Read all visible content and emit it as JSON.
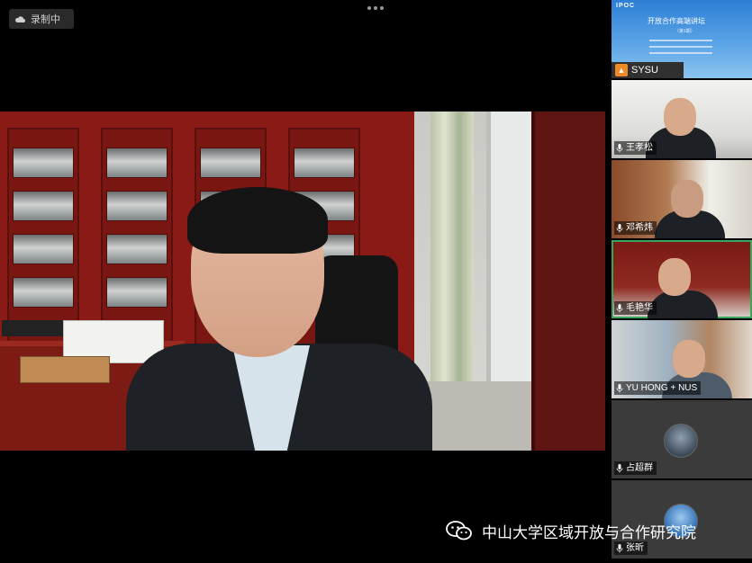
{
  "top_bar": {
    "recording_label": "录制中"
  },
  "main_speaker": {
    "name": ""
  },
  "sidebar": {
    "shared_screen": {
      "slide_logo": "IPOC",
      "slide_title": "开放合作高端讲坛",
      "slide_subtitle": "（第1期）",
      "presenter": "SYSU"
    },
    "participants": [
      {
        "name": "王孝松",
        "active": false
      },
      {
        "name": "邓希炜",
        "active": false
      },
      {
        "name": "毛艳华",
        "active": true
      },
      {
        "name": "YU HONG + NUS",
        "active": false
      },
      {
        "name": "占超群",
        "active": false
      },
      {
        "name": "张昕",
        "active": false
      }
    ]
  },
  "watermark": {
    "text": "中山大学区域开放与合作研究院"
  },
  "colors": {
    "active_border": "#3aa55d",
    "share_icon": "#f08a24",
    "slide_blue": "#2d7fd6"
  },
  "icons": [
    "cloud-icon",
    "more-icon",
    "share-screen-icon",
    "mic-icon",
    "wechat-icon"
  ]
}
